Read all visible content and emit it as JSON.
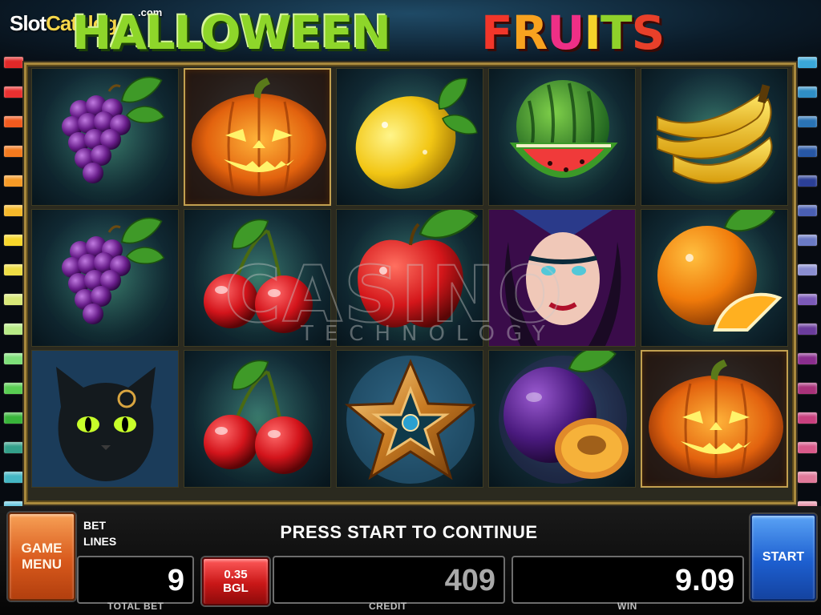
{
  "watermark": {
    "site_name": "SlotCatalog",
    "site_suffix": ".com",
    "provider_main": "CASINO",
    "provider_sub": "TECHNOLOGY"
  },
  "game": {
    "title_word1": "HALLOWEEN",
    "title_word2": "FRUITS"
  },
  "reels": [
    [
      "grapes",
      "grapes",
      "black-cat"
    ],
    [
      "pumpkin",
      "cherries",
      "cherries"
    ],
    [
      "lemon",
      "apple",
      "pentagram-star"
    ],
    [
      "watermelon",
      "witch",
      "plum"
    ],
    [
      "banana",
      "orange",
      "pumpkin"
    ]
  ],
  "highlighted_cells": [
    "reel-2-row-1",
    "reel-5-row-3"
  ],
  "line_marker_colors_left": [
    "#e02828",
    "#e83030",
    "#f05a1e",
    "#f37a1e",
    "#f59a26",
    "#f5b82a",
    "#f7d62a",
    "#eedd44",
    "#d8e878",
    "#b7ea86",
    "#7ee07a",
    "#58cd52",
    "#38b43a",
    "#33a08a",
    "#44b6c4",
    "#68c8e0"
  ],
  "line_marker_colors_right": [
    "#3aa7d8",
    "#2f8ec4",
    "#2a73b4",
    "#2757a4",
    "#2b3f96",
    "#4a5fb2",
    "#6a7ac4",
    "#8a8ed0",
    "#7b5ab8",
    "#6a3c9c",
    "#8a2e8e",
    "#a8327a",
    "#c8407e",
    "#d85a8a",
    "#e07a9a",
    "#e896aa"
  ],
  "controls": {
    "menu_line1": "GAME",
    "menu_line2": "MENU",
    "start_label": "START",
    "bet_label": "BET",
    "lines_label": "LINES",
    "message": "PRESS START TO CONTINUE",
    "total_bet_value": "9",
    "total_bet_caption": "TOTAL BET",
    "bet_button_value": "0.35",
    "bet_button_currency": "BGL",
    "credit_value": "409",
    "credit_caption": "CREDIT",
    "win_value": "9.09",
    "win_caption": "WIN"
  },
  "colors": {
    "menu_button": "#d8591c",
    "start_button": "#1d5fd0",
    "bet_button": "#c91717",
    "credit_text": "#a9a9a9",
    "win_text": "#ffffff",
    "total_bet_text": "#ffffff"
  }
}
